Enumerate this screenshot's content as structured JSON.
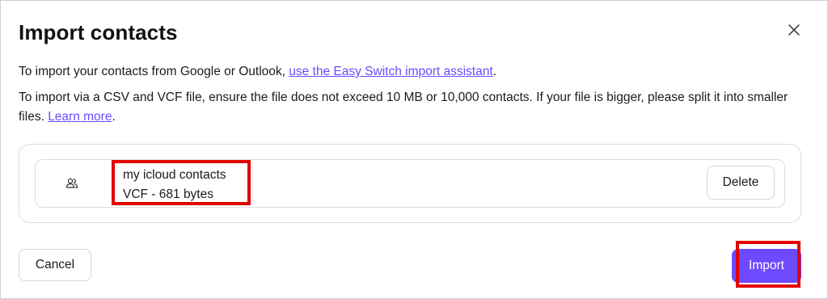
{
  "dialog": {
    "title": "Import contacts",
    "close_icon": "close-icon"
  },
  "intro": {
    "text_before": "To import your contacts from Google or Outlook, ",
    "link_label": "use the Easy Switch import assistant",
    "text_after": "."
  },
  "instructions": {
    "text_before": "To import via a CSV and VCF file, ensure the file does not exceed 10 MB or 10,000 contacts. If your file is bigger, please split it into smaller files. ",
    "link_label": "Learn more",
    "text_after": "."
  },
  "file": {
    "icon": "contacts-icon",
    "name": "my icloud contacts",
    "meta": "VCF - 681 bytes",
    "delete_label": "Delete"
  },
  "footer": {
    "cancel_label": "Cancel",
    "import_label": "Import"
  },
  "colors": {
    "accent": "#6d4aff",
    "highlight": "#e00000"
  }
}
